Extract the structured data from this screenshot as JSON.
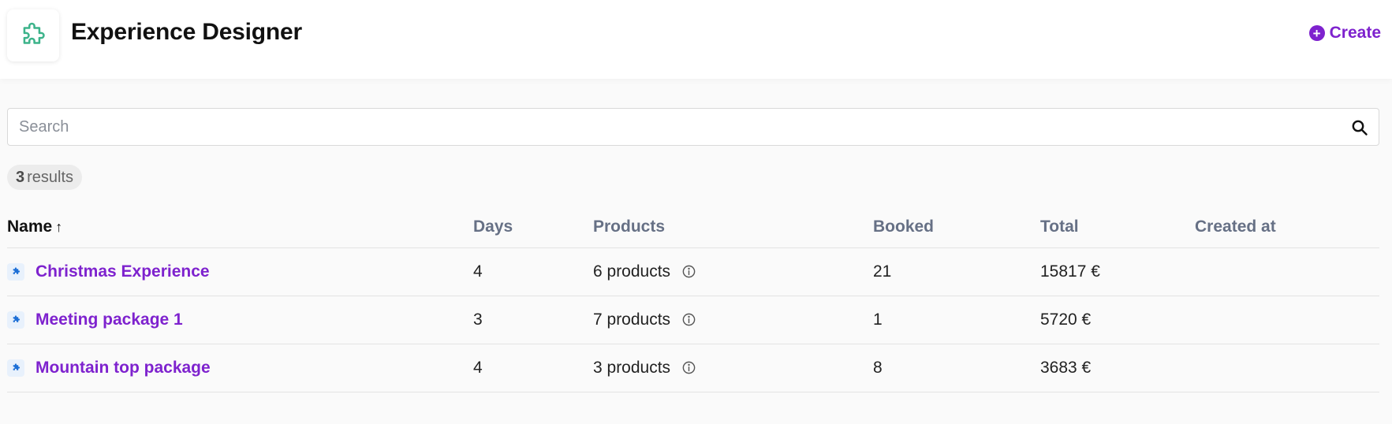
{
  "header": {
    "title": "Experience Designer",
    "create_label": "Create",
    "logo_icon": "puzzle-icon",
    "accent_color": "#7e22ce",
    "logo_color": "#3cb38a"
  },
  "search": {
    "placeholder": "Search",
    "value": ""
  },
  "results": {
    "count": "3",
    "label": "results"
  },
  "table": {
    "columns": {
      "name": "Name",
      "name_sort": "↑",
      "days": "Days",
      "products": "Products",
      "booked": "Booked",
      "total": "Total",
      "created_at": "Created at"
    },
    "rows": [
      {
        "name": "Christmas Experience",
        "days": "4",
        "products": "6 products",
        "booked": "21",
        "total": "15817 €",
        "created_at": ""
      },
      {
        "name": "Meeting package 1",
        "days": "3",
        "products": "7 products",
        "booked": "1",
        "total": "5720 €",
        "created_at": ""
      },
      {
        "name": "Mountain top package",
        "days": "4",
        "products": "3 products",
        "booked": "8",
        "total": "3683 €",
        "created_at": ""
      }
    ]
  }
}
